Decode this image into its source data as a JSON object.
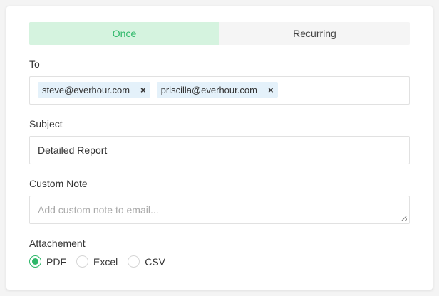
{
  "frequency": {
    "tabs": [
      {
        "label": "Once",
        "active": true
      },
      {
        "label": "Recurring",
        "active": false
      }
    ]
  },
  "to": {
    "label": "To",
    "recipients": [
      "steve@everhour.com",
      "priscilla@everhour.com"
    ],
    "remove_glyph": "×"
  },
  "subject": {
    "label": "Subject",
    "value": "Detailed Report"
  },
  "note": {
    "label": "Custom Note",
    "placeholder": "Add custom note to email..."
  },
  "attachment": {
    "label": "Attachement",
    "options": [
      "PDF",
      "Excel",
      "CSV"
    ],
    "selected": "PDF"
  },
  "colors": {
    "accent": "#2fb86a",
    "active_tab_bg": "#d5f3df",
    "chip_bg": "#e4f1fa"
  }
}
